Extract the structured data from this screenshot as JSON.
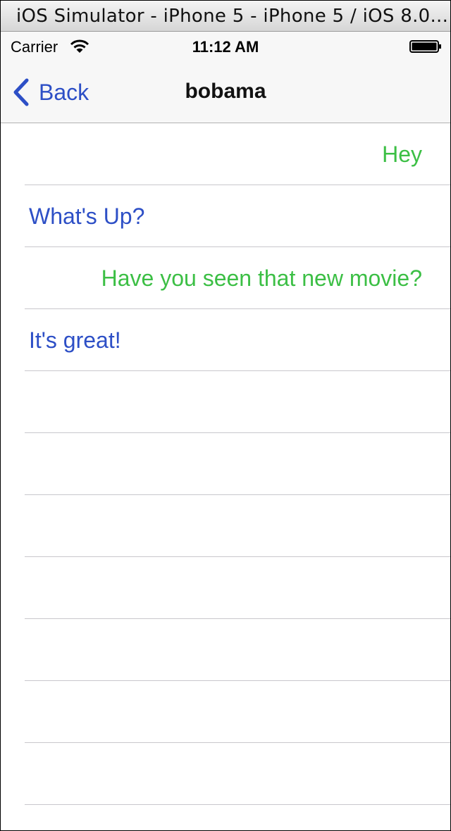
{
  "window": {
    "title": "iOS Simulator - iPhone 5 - iPhone 5 / iOS 8.0..."
  },
  "status_bar": {
    "carrier": "Carrier",
    "time": "11:12 AM",
    "icons": [
      "wifi-icon",
      "battery-icon"
    ]
  },
  "nav_bar": {
    "back_label": "Back",
    "back_icon": "chevron-left-icon",
    "title": "bobama"
  },
  "colors": {
    "outgoing": "#3cbf45",
    "incoming": "#2d4fc6",
    "tint": "#2d4fc6"
  },
  "messages": [
    {
      "text": "Hey",
      "direction": "outgoing"
    },
    {
      "text": "What's Up?",
      "direction": "incoming"
    },
    {
      "text": "Have you seen that new movie?",
      "direction": "outgoing"
    },
    {
      "text": "It's great!",
      "direction": "incoming"
    },
    {
      "text": "",
      "direction": ""
    },
    {
      "text": "",
      "direction": ""
    },
    {
      "text": "",
      "direction": ""
    },
    {
      "text": "",
      "direction": ""
    },
    {
      "text": "",
      "direction": ""
    },
    {
      "text": "",
      "direction": ""
    },
    {
      "text": "",
      "direction": ""
    },
    {
      "text": "",
      "direction": ""
    }
  ]
}
